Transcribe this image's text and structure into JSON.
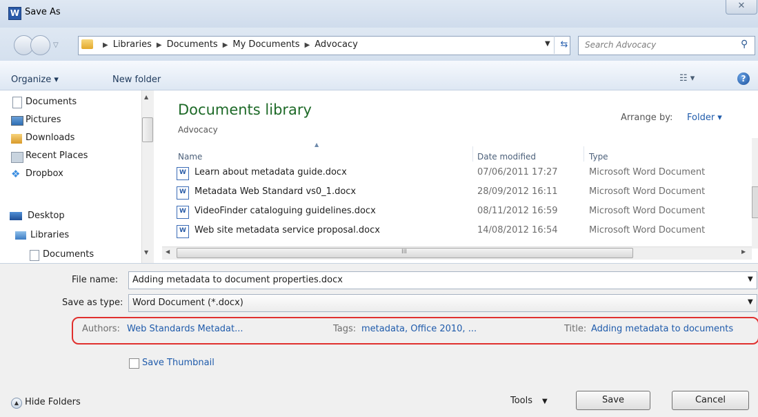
{
  "window": {
    "title": "Save As",
    "app_logo_letter": "W",
    "close_symbol": "✕"
  },
  "address": {
    "crumbs": [
      "Libraries",
      "Documents",
      "My Documents",
      "Advocacy"
    ],
    "search_placeholder": "Search Advocacy"
  },
  "toolbar": {
    "organize": "Organize ▾",
    "new_folder": "New folder"
  },
  "nav": {
    "items": [
      "Documents",
      "Pictures",
      "Downloads",
      "Recent Places",
      "Dropbox",
      "Desktop",
      "Libraries",
      "Documents"
    ]
  },
  "library": {
    "title": "Documents library",
    "subtitle": "Advocacy",
    "arrange_label": "Arrange by:",
    "arrange_value": "Folder ▾"
  },
  "columns": {
    "name": "Name",
    "date": "Date modified",
    "type": "Type"
  },
  "files": [
    {
      "name": "Learn about metadata guide.docx",
      "date": "07/06/2011 17:27",
      "type": "Microsoft Word Document"
    },
    {
      "name": "Metadata Web Standard vs0_1.docx",
      "date": "28/09/2012 16:11",
      "type": "Microsoft Word Document"
    },
    {
      "name": "VideoFinder cataloguing guidelines.docx",
      "date": "08/11/2012 16:59",
      "type": "Microsoft Word Document"
    },
    {
      "name": "Web site metadata service proposal.docx",
      "date": "14/08/2012 16:54",
      "type": "Microsoft Word Document"
    }
  ],
  "form": {
    "filename_label": "File name:",
    "filename_value": "Adding metadata to document properties.docx",
    "savetype_label": "Save as type:",
    "savetype_value": "Word Document (*.docx)"
  },
  "meta": {
    "authors_label": "Authors:",
    "authors_value": "Web Standards Metadat...",
    "tags_label": "Tags:",
    "tags_value": "metadata, Office 2010, ...",
    "title_label": "Title:",
    "title_value": "Adding metadata to documents"
  },
  "options": {
    "save_thumbnail": "Save Thumbnail",
    "hide_folders": "Hide Folders"
  },
  "buttons": {
    "tools": "Tools",
    "save": "Save",
    "cancel": "Cancel"
  },
  "colors": {
    "library_title": "#1e6a28",
    "link_blue": "#1f5bab",
    "highlight_red": "#e0302e"
  }
}
